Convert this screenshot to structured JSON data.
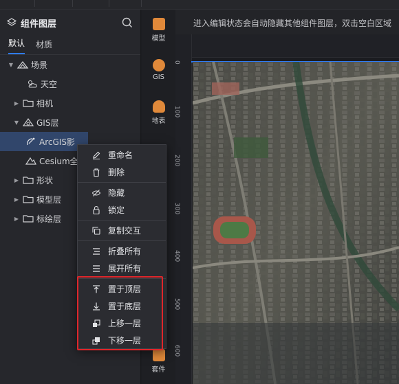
{
  "panel": {
    "title": "组件图层",
    "tabs": [
      "默认",
      "材质"
    ]
  },
  "tree": [
    {
      "label": "场景",
      "arrow": "▼",
      "icon": "scene-icon"
    },
    {
      "label": "天空",
      "arrow": "",
      "icon": "weather-icon"
    },
    {
      "label": "相机",
      "arrow": "▶",
      "icon": "folder-icon"
    },
    {
      "label": "GIS层",
      "arrow": "▼",
      "icon": "gis-layer-icon"
    },
    {
      "label": "ArcGIS影",
      "arrow": "",
      "icon": "satellite-icon",
      "selected": true
    },
    {
      "label": "Cesium全",
      "arrow": "",
      "icon": "terrain-icon"
    },
    {
      "label": "形状",
      "arrow": "▶",
      "icon": "folder-icon"
    },
    {
      "label": "模型层",
      "arrow": "▶",
      "icon": "folder-icon"
    },
    {
      "label": "标绘层",
      "arrow": "▶",
      "icon": "folder-icon"
    }
  ],
  "rail": [
    {
      "label": "模型",
      "icon": "model-icon",
      "color": "#e0893a"
    },
    {
      "label": "GIS",
      "icon": "gis-icon",
      "color": "#e0893a"
    },
    {
      "label": "地表",
      "icon": "terrain-icon",
      "color": "#e0893a"
    },
    {
      "label": "套件",
      "icon": "kit-icon",
      "color": "#e0893a"
    }
  ],
  "canvas": {
    "hint": "进入编辑状态会自动隐藏其他组件图层，双击空白区域",
    "ruler_labels": [
      "0",
      "100",
      "200",
      "300",
      "400",
      "500",
      "600"
    ]
  },
  "menu": {
    "items": [
      {
        "label": "重命名",
        "icon": "pencil-icon"
      },
      {
        "label": "删除",
        "icon": "trash-icon"
      },
      {
        "label": "隐藏",
        "icon": "eye-off-icon"
      },
      {
        "label": "锁定",
        "icon": "lock-icon"
      },
      {
        "label": "复制交互",
        "icon": "copy-icon"
      },
      {
        "label": "折叠所有",
        "icon": "collapse-icon"
      },
      {
        "label": "展开所有",
        "icon": "expand-icon"
      },
      {
        "label": "置于顶层",
        "icon": "to-top-icon"
      },
      {
        "label": "置于底层",
        "icon": "to-bottom-icon"
      },
      {
        "label": "上移一层",
        "icon": "move-up-icon"
      },
      {
        "label": "下移一层",
        "icon": "move-down-icon"
      }
    ]
  },
  "colors": {
    "accent": "#2f7cf6",
    "highlight": "#e0262b",
    "selection": "#31466b"
  }
}
